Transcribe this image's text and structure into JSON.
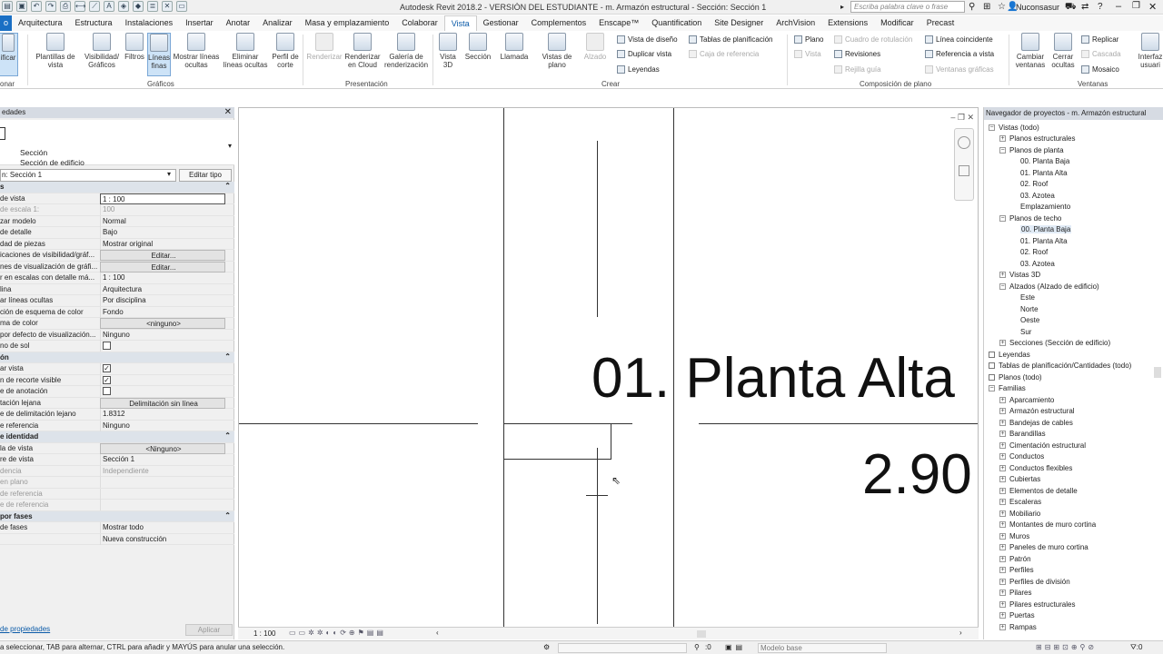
{
  "title_bar": {
    "title": "Autodesk Revit 2018.2 - VERSIÓN DEL ESTUDIANTE -    m. Armazón estructural - Sección: Sección 1",
    "search_placeholder": "Escriba palabra clave o frase",
    "user": "Nuconsasur"
  },
  "tabs": [
    "o",
    "Arquitectura",
    "Estructura",
    "Instalaciones",
    "Insertar",
    "Anotar",
    "Analizar",
    "Masa y emplazamiento",
    "Colaborar",
    "Vista",
    "Gestionar",
    "Complementos",
    "Enscape™",
    "Quantification",
    "Site Designer",
    "ArchVision",
    "Extensions",
    "Modificar",
    "Precast"
  ],
  "active_tab": "Vista",
  "ribbon": {
    "modify": "ificar",
    "modify_panel": "onar",
    "graphics": [
      {
        "label": "Plantillas de vista",
        "icon": "template-icon"
      },
      {
        "label": "Visibilidad/ Gráficos",
        "icon": "visibility-icon"
      },
      {
        "label": "Filtros",
        "icon": "filter-icon"
      },
      {
        "label": "Líneas finas",
        "icon": "thin-lines-icon"
      },
      {
        "label": "Mostrar líneas ocultas",
        "icon": "hidden-lines-icon"
      },
      {
        "label": "Eliminar líneas ocultas",
        "icon": "remove-hidden-icon"
      },
      {
        "label": "Perfil de corte",
        "icon": "cut-profile-icon"
      }
    ],
    "graphics_panel": "Gráficos",
    "presentation": [
      {
        "label": "Renderizar",
        "icon": "render-icon"
      },
      {
        "label": "Renderizar en Cloud",
        "icon": "cloud-render-icon"
      },
      {
        "label": "Galería de renderización",
        "icon": "gallery-icon"
      }
    ],
    "presentation_panel": "Presentación",
    "create": [
      {
        "label": "Vista 3D",
        "icon": "3d-view-icon"
      },
      {
        "label": "Sección",
        "icon": "section-icon"
      },
      {
        "label": "Llamada",
        "icon": "callout-icon"
      },
      {
        "label": "Vistas de plano",
        "icon": "plan-views-icon"
      },
      {
        "label": "Alzado",
        "icon": "elevation-icon"
      }
    ],
    "create_small": [
      "Vista de diseño",
      "Duplicar vista",
      "Leyendas",
      "Tablas de planificación",
      "Caja de referencia"
    ],
    "create_panel": "Crear",
    "sheet": [
      "Plano",
      "Vista",
      "Cuadro de rotulación",
      "Revisiones",
      "Rejilla guía",
      "Línea coincidente",
      "Referencia a vista",
      "Ventanas gráficas"
    ],
    "sheet_panel": "Composición de plano",
    "windows": [
      {
        "label": "Cambiar ventanas",
        "icon": "switch-windows-icon"
      },
      {
        "label": "Cerrar ocultas",
        "icon": "close-hidden-icon"
      }
    ],
    "windows_small": [
      "Replicar",
      "Cascada",
      "Mosaico"
    ],
    "ui": "Interfaz usuari",
    "windows_panel": "Ventanas"
  },
  "properties": {
    "header": "edades",
    "type_name": "Sección",
    "type_family": "Sección de edificio",
    "instance": "n: Sección 1",
    "edit_type": "Editar tipo",
    "rows": [
      {
        "k": "s",
        "v": "",
        "group": true
      },
      {
        "k": "de vista",
        "v": "1 : 100",
        "active": true
      },
      {
        "k": "de escala    1:",
        "v": "100",
        "dim": true
      },
      {
        "k": "zar modelo",
        "v": "Normal"
      },
      {
        "k": "de detalle",
        "v": "Bajo"
      },
      {
        "k": "dad de piezas",
        "v": "Mostrar original"
      },
      {
        "k": "icaciones de visibilidad/gráf...",
        "v": "Editar...",
        "btn": true
      },
      {
        "k": "nes de visualización de gráfi...",
        "v": "Editar...",
        "btn": true
      },
      {
        "k": "r en escalas con detalle má...",
        "v": "1 : 100"
      },
      {
        "k": "lina",
        "v": "Arquitectura"
      },
      {
        "k": "ar líneas ocultas",
        "v": "Por disciplina"
      },
      {
        "k": "ción de esquema de color",
        "v": "Fondo"
      },
      {
        "k": "ma de color",
        "v": "<ninguno>",
        "btn": true
      },
      {
        "k": "por defecto de visualización...",
        "v": "Ninguno"
      },
      {
        "k": "no de sol",
        "v": "",
        "check": false
      },
      {
        "k": "ón",
        "v": "",
        "group": true
      },
      {
        "k": "ar vista",
        "v": "",
        "check": true
      },
      {
        "k": "n de recorte visible",
        "v": "",
        "check": true
      },
      {
        "k": "e de anotación",
        "v": "",
        "check": false
      },
      {
        "k": "tación lejana",
        "v": "Delimitación sin línea",
        "btn": true
      },
      {
        "k": "e de delimitación lejano",
        "v": "1.8312"
      },
      {
        "k": "e referencia",
        "v": "Ninguno"
      },
      {
        "k": "e identidad",
        "v": "",
        "group": true
      },
      {
        "k": "la de vista",
        "v": "<Ninguno>",
        "btn": true
      },
      {
        "k": "re de vista",
        "v": "Sección 1"
      },
      {
        "k": "dencia",
        "v": "Independiente",
        "dim": true
      },
      {
        "k": "en plano",
        "v": "",
        "dim": true
      },
      {
        "k": "de referencia",
        "v": "",
        "dim": true
      },
      {
        "k": "e de referencia",
        "v": "",
        "dim": true
      },
      {
        "k": "por fases",
        "v": "",
        "group": true
      },
      {
        "k": "de fases",
        "v": "Mostrar todo"
      },
      {
        "k": "",
        "v": "Nueva construcción"
      }
    ],
    "help_link": "de propiedades",
    "apply": "Aplicar"
  },
  "canvas": {
    "level_name": "01. Planta Alta",
    "level_elev": "2.90",
    "scale": "1 : 100"
  },
  "browser": {
    "header": "Navegador de proyectos - m. Armazón estructural",
    "nodes": [
      {
        "t": "Vistas (todo)",
        "d": 0,
        "tog": "−"
      },
      {
        "t": "Planos estructurales",
        "d": 1,
        "tog": "+"
      },
      {
        "t": "Planos de planta",
        "d": 1,
        "tog": "−"
      },
      {
        "t": "00. Planta Baja",
        "d": 2
      },
      {
        "t": "01. Planta Alta",
        "d": 2
      },
      {
        "t": "02. Roof",
        "d": 2
      },
      {
        "t": "03. Azotea",
        "d": 2
      },
      {
        "t": "Emplazamiento",
        "d": 2
      },
      {
        "t": "Planos de techo",
        "d": 1,
        "tog": "−"
      },
      {
        "t": "00. Planta Baja",
        "d": 2,
        "sel": true
      },
      {
        "t": "01. Planta Alta",
        "d": 2
      },
      {
        "t": "02. Roof",
        "d": 2
      },
      {
        "t": "03. Azotea",
        "d": 2
      },
      {
        "t": "Vistas 3D",
        "d": 1,
        "tog": "+"
      },
      {
        "t": "Alzados (Alzado de edificio)",
        "d": 1,
        "tog": "−"
      },
      {
        "t": "Este",
        "d": 2
      },
      {
        "t": "Norte",
        "d": 2
      },
      {
        "t": "Oeste",
        "d": 2
      },
      {
        "t": "Sur",
        "d": 2
      },
      {
        "t": "Secciones (Sección de edificio)",
        "d": 1,
        "tog": "+"
      },
      {
        "t": "Leyendas",
        "d": 0
      },
      {
        "t": "Tablas de planificación/Cantidades (todo)",
        "d": 0
      },
      {
        "t": "Planos (todo)",
        "d": 0
      },
      {
        "t": "Familias",
        "d": 0,
        "tog": "−"
      },
      {
        "t": "Aparcamiento",
        "d": 1,
        "tog": "+"
      },
      {
        "t": "Armazón estructural",
        "d": 1,
        "tog": "+"
      },
      {
        "t": "Bandejas de cables",
        "d": 1,
        "tog": "+"
      },
      {
        "t": "Barandillas",
        "d": 1,
        "tog": "+"
      },
      {
        "t": "Cimentación estructural",
        "d": 1,
        "tog": "+"
      },
      {
        "t": "Conductos",
        "d": 1,
        "tog": "+"
      },
      {
        "t": "Conductos flexibles",
        "d": 1,
        "tog": "+"
      },
      {
        "t": "Cubiertas",
        "d": 1,
        "tog": "+"
      },
      {
        "t": "Elementos de detalle",
        "d": 1,
        "tog": "+"
      },
      {
        "t": "Escaleras",
        "d": 1,
        "tog": "+"
      },
      {
        "t": "Mobiliario",
        "d": 1,
        "tog": "+"
      },
      {
        "t": "Montantes de muro cortina",
        "d": 1,
        "tog": "+"
      },
      {
        "t": "Muros",
        "d": 1,
        "tog": "+"
      },
      {
        "t": "Paneles de muro cortina",
        "d": 1,
        "tog": "+"
      },
      {
        "t": "Patrón",
        "d": 1,
        "tog": "+"
      },
      {
        "t": "Perfiles",
        "d": 1,
        "tog": "+"
      },
      {
        "t": "Perfiles de división",
        "d": 1,
        "tog": "+"
      },
      {
        "t": "Pilares",
        "d": 1,
        "tog": "+"
      },
      {
        "t": "Pilares estructurales",
        "d": 1,
        "tog": "+"
      },
      {
        "t": "Puertas",
        "d": 1,
        "tog": "+"
      },
      {
        "t": "Rampas",
        "d": 1,
        "tog": "+"
      }
    ]
  },
  "status": {
    "text": "a seleccionar, TAB para alternar, CTRL para añadir y MAYÚS para anular una selección.",
    "sel_count": ":0",
    "model": "Modelo base"
  }
}
